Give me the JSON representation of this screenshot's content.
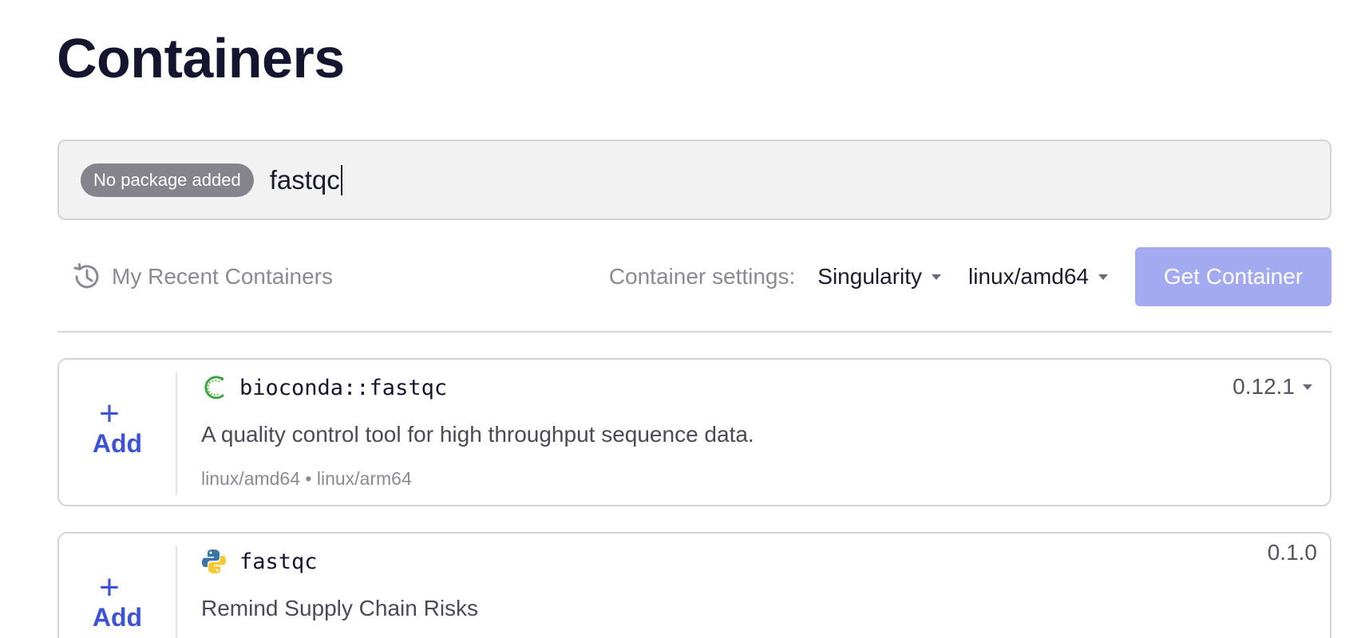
{
  "page": {
    "title": "Containers"
  },
  "search": {
    "chip": "No package added",
    "value": "fastqc"
  },
  "toolbar": {
    "recent_label": "My Recent Containers",
    "settings_label": "Container settings:",
    "container_type": "Singularity",
    "platform": "linux/amd64",
    "get_button": "Get Container"
  },
  "results": [
    {
      "add_plus": "+",
      "add_label": "Add",
      "icon": "bioconda-icon",
      "name": "bioconda::fastqc",
      "description": "A quality control tool for high throughput sequence data.",
      "platforms": "linux/amd64 • linux/arm64",
      "version": "0.12.1"
    },
    {
      "add_plus": "+",
      "add_label": "Add",
      "icon": "python-icon",
      "name": "fastqc",
      "description": "Remind Supply Chain Risks",
      "version": "0.1.0"
    }
  ],
  "colors": {
    "accent": "#3d52d5",
    "button_disabled": "#a3aaf0",
    "chip_bg": "#85838c"
  }
}
